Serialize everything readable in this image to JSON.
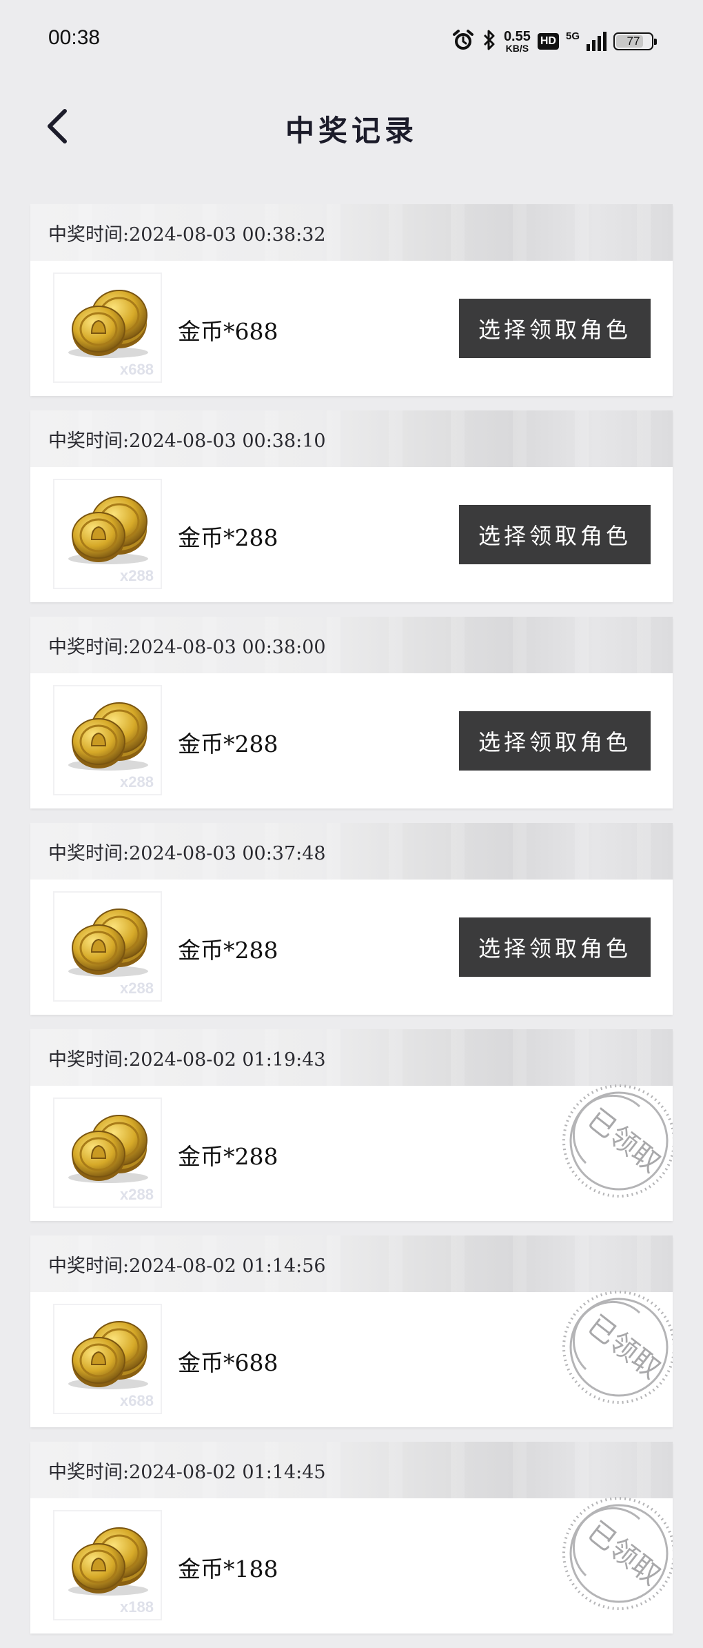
{
  "status_bar": {
    "time": "00:38",
    "speed_value": "0.55",
    "speed_unit": "KB/S",
    "hd_label": "HD",
    "network_label": "5G",
    "battery": "77",
    "battery_fraction": 0.77
  },
  "header": {
    "title": "中奖记录"
  },
  "records": [
    {
      "time_label": "中奖时间:2024-08-03 00:38:32",
      "prize": "金币*688",
      "qty_badge": "x688",
      "action_label": "选择领取角色",
      "claimed": false
    },
    {
      "time_label": "中奖时间:2024-08-03 00:38:10",
      "prize": "金币*288",
      "qty_badge": "x288",
      "action_label": "选择领取角色",
      "claimed": false
    },
    {
      "time_label": "中奖时间:2024-08-03 00:38:00",
      "prize": "金币*288",
      "qty_badge": "x288",
      "action_label": "选择领取角色",
      "claimed": false
    },
    {
      "time_label": "中奖时间:2024-08-03 00:37:48",
      "prize": "金币*288",
      "qty_badge": "x288",
      "action_label": "选择领取角色",
      "claimed": false
    },
    {
      "time_label": "中奖时间:2024-08-02 01:19:43",
      "prize": "金币*288",
      "qty_badge": "x288",
      "stamp_label": "已领取",
      "claimed": true
    },
    {
      "time_label": "中奖时间:2024-08-02 01:14:56",
      "prize": "金币*688",
      "qty_badge": "x688",
      "stamp_label": "已领取",
      "claimed": true
    },
    {
      "time_label": "中奖时间:2024-08-02 01:14:45",
      "prize": "金币*188",
      "qty_badge": "x188",
      "stamp_label": "已领取",
      "claimed": true
    }
  ],
  "colors": {
    "page_bg": "#ececee",
    "button_bg": "#3b3b3c",
    "stamp": "#b4b4b6",
    "coin_gold": "#d6a928"
  },
  "icons": {
    "back": "chevron-left-icon",
    "coins": "gold-coins-icon",
    "alarm": "alarm-icon",
    "bluetooth": "bluetooth-icon",
    "signal": "signal-icon",
    "battery": "battery-icon"
  }
}
